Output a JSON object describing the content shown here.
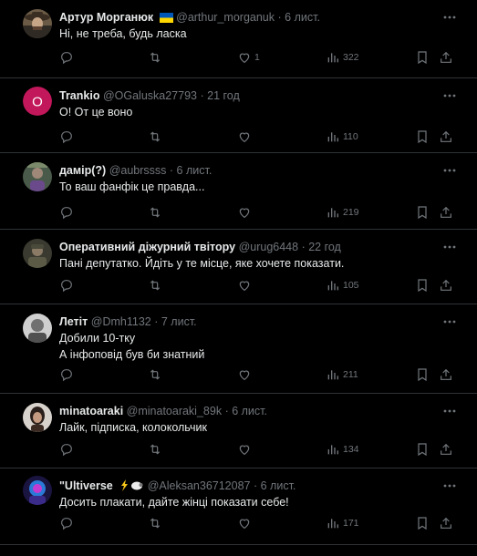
{
  "tweets": [
    {
      "name": "Артур Морганюк",
      "badge": "ukraine-flag",
      "handle": "@arthur_morganuk",
      "time": "6 лист.",
      "lines": [
        "Ні, не треба, будь ласка"
      ],
      "likes": "1",
      "views": "322",
      "avatar": "cowboy-photo"
    },
    {
      "name": "Trankio",
      "handle": "@OGaluska27793",
      "time": "21 год",
      "lines": [
        "О! От це воно"
      ],
      "likes": "",
      "views": "110",
      "avatar": "letter",
      "avatar_letter": "O",
      "avatar_color": "#c2185b"
    },
    {
      "name": "дамір(?)",
      "handle": "@aubrssss",
      "time": "6 лист.",
      "lines": [
        "То ваш фанфік це правда..."
      ],
      "likes": "",
      "views": "219",
      "avatar": "person-photo"
    },
    {
      "name": "Оперативний діжурний твітору",
      "handle": "@urug6448",
      "time": "22 год",
      "lines": [
        "Пані депутатко. Йдіть у те місце, яке хочете показати."
      ],
      "likes": "",
      "views": "105",
      "avatar": "soldier-photo"
    },
    {
      "name": "Летіт",
      "handle": "@Dmh1132",
      "time": "7 лист.",
      "lines": [
        "Добили 10-тку",
        "А інфоповід був би знатний"
      ],
      "likes": "",
      "views": "211",
      "avatar": "bw-photo"
    },
    {
      "name": "minatoaraki",
      "handle": "@minatoaraki_89k",
      "time": "6 лист.",
      "lines": [
        "Лайк, підписка, колокольчик"
      ],
      "likes": "",
      "views": "134",
      "avatar": "woman-photo"
    },
    {
      "name": "\"Ultiverse",
      "badge": "lightning-sheep-emoji",
      "handle": "@Aleksan36712087",
      "time": "6 лист.",
      "lines": [
        "Досить плакати, дайте жінці показати себе!"
      ],
      "likes": "",
      "views": "171",
      "avatar": "robot-art"
    }
  ],
  "separator": "·",
  "colors": {
    "background": "#000000",
    "text": "#e7e9ea",
    "muted": "#71767b",
    "border": "#2f3336"
  },
  "icons": [
    "more-icon",
    "reply-icon",
    "retweet-icon",
    "like-icon",
    "views-icon",
    "bookmark-icon",
    "share-icon"
  ]
}
